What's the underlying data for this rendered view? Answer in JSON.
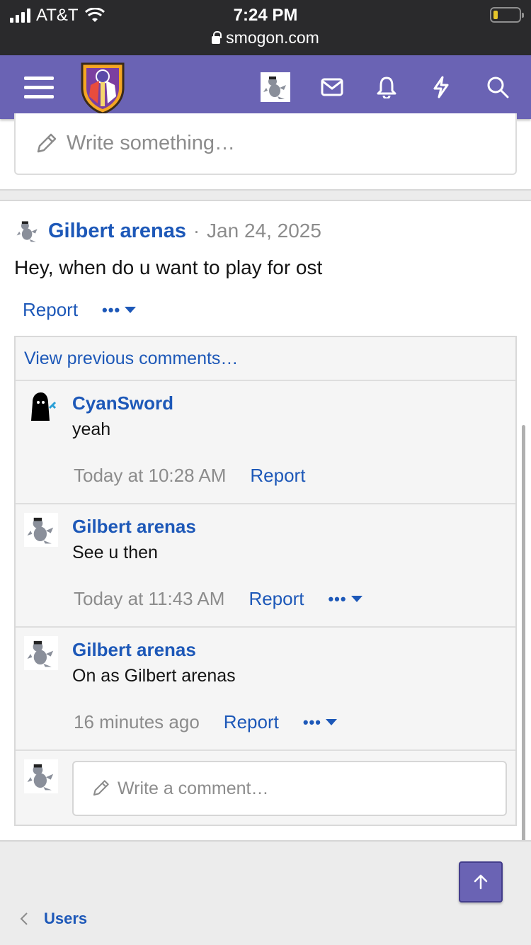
{
  "status_bar": {
    "carrier": "AT&T",
    "time": "7:24 PM",
    "url": "smogon.com",
    "battery_level": 0.18
  },
  "nav": {
    "icons": [
      "menu-icon",
      "smogon-logo",
      "user-avatar",
      "mail-icon",
      "bell-icon",
      "bolt-icon",
      "search-icon"
    ],
    "color": "#6a63b4"
  },
  "status_composer": {
    "placeholder": "Write something…"
  },
  "post": {
    "author": "Gilbert arenas",
    "separator": "·",
    "date": "Jan 24, 2025",
    "body": "Hey, when do u want to play for ost",
    "report_label": "Report",
    "more_label": "•••"
  },
  "comments": {
    "view_previous": "View previous comments…",
    "items": [
      {
        "author": "CyanSword",
        "text": "yeah",
        "time": "Today at 10:28 AM",
        "report_label": "Report"
      },
      {
        "author": "Gilbert arenas",
        "text": "See u then",
        "time": "Today at 11:43 AM",
        "report_label": "Report",
        "more_label": "•••"
      },
      {
        "author": "Gilbert arenas",
        "text": "On as Gilbert arenas",
        "time": "16 minutes ago",
        "report_label": "Report",
        "more_label": "•••"
      }
    ],
    "reply_placeholder": "Write a comment…"
  },
  "footer": {
    "breadcrumb_label": "Users"
  },
  "colors": {
    "link": "#1d58b8",
    "accent": "#6a63b4",
    "muted": "#8c8c8c"
  }
}
